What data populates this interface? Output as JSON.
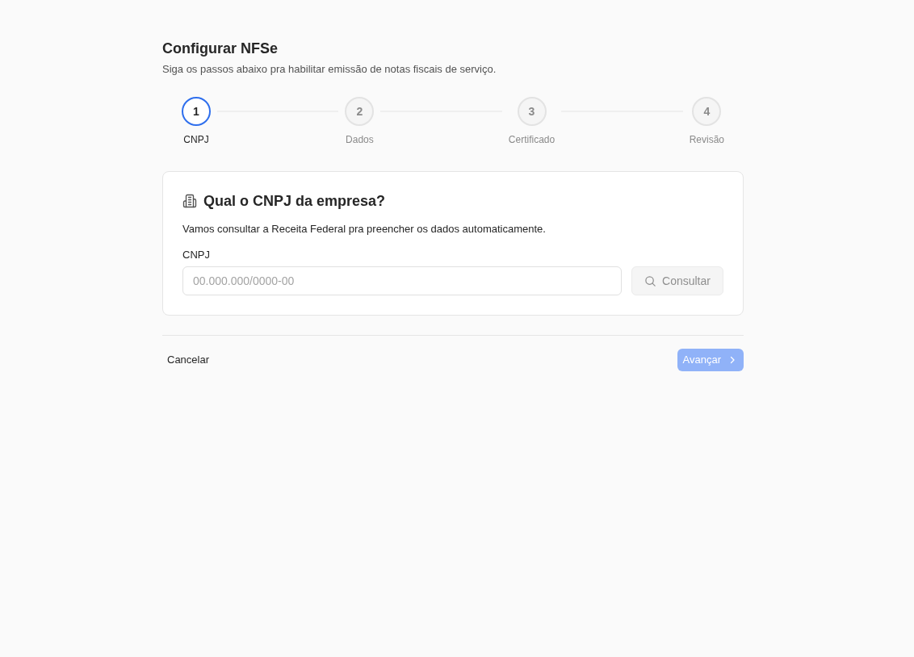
{
  "header": {
    "title": "Configurar NFSe",
    "subtitle": "Siga os passos abaixo pra habilitar emissão de notas fiscais de serviço."
  },
  "steps": [
    {
      "number": "1",
      "label": "CNPJ",
      "selected": true
    },
    {
      "number": "2",
      "label": "Dados",
      "selected": false
    },
    {
      "number": "3",
      "label": "Certificado",
      "selected": false
    },
    {
      "number": "4",
      "label": "Revisão",
      "selected": false
    }
  ],
  "card": {
    "title": "Qual o CNPJ da empresa?",
    "description": "Vamos consultar a Receita Federal pra preencher os dados automaticamente.",
    "field": {
      "label": "CNPJ",
      "placeholder": "00.000.000/0000-00"
    },
    "lookup_button": {
      "label": "Consultar",
      "disabled": true
    }
  },
  "footer": {
    "cancel_button": {
      "label": "Cancelar"
    },
    "next_button": {
      "label": "Avançar",
      "disabled": true
    }
  }
}
